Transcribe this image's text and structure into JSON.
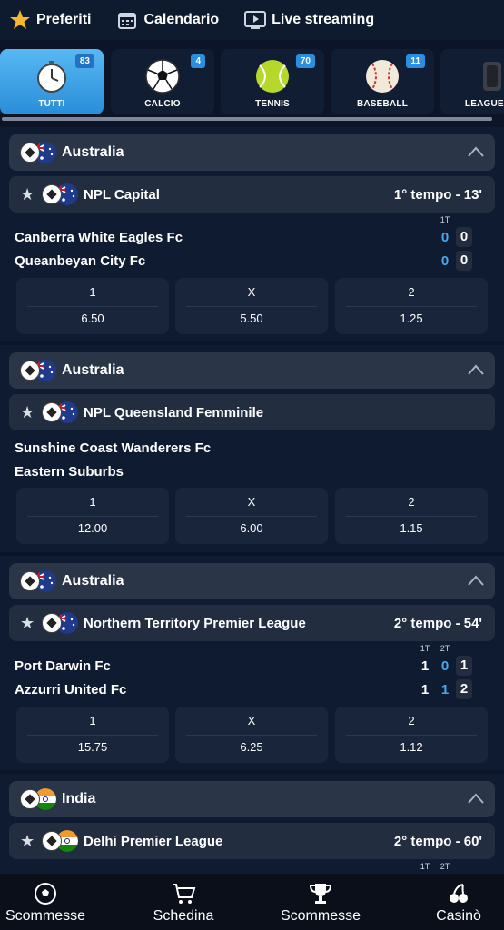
{
  "topnav": {
    "favorites": "Preferiti",
    "calendar": "Calendario",
    "live": "Live streaming"
  },
  "sports": [
    {
      "label": "TUTTI",
      "count": "83",
      "icon": "stopwatch-icon"
    },
    {
      "label": "CALCIO",
      "count": "4",
      "icon": "soccer-ball-icon"
    },
    {
      "label": "TENNIS",
      "count": "70",
      "icon": "tennis-ball-icon"
    },
    {
      "label": "BASEBALL",
      "count": "11",
      "icon": "baseball-icon"
    },
    {
      "label": "LEAGUE OF",
      "icon": "league-of-legends-icon"
    }
  ],
  "sections": [
    {
      "country": "Australia",
      "competition": "NPL Capital",
      "status": "1° tempo - 13'",
      "period_labels": [
        "1T"
      ],
      "home": "Canberra White Eagles Fc",
      "away": "Queanbeyan City Fc",
      "home_scores": [
        "0",
        "0"
      ],
      "away_scores": [
        "0",
        "0"
      ],
      "odds": [
        {
          "k": "1",
          "v": "6.50"
        },
        {
          "k": "X",
          "v": "5.50"
        },
        {
          "k": "2",
          "v": "1.25"
        }
      ]
    },
    {
      "country": "Australia",
      "competition": "NPL Queensland Femminile",
      "status": "",
      "home": "Sunshine Coast Wanderers Fc",
      "away": "Eastern Suburbs",
      "odds": [
        {
          "k": "1",
          "v": "12.00"
        },
        {
          "k": "X",
          "v": "6.00"
        },
        {
          "k": "2",
          "v": "1.15"
        }
      ]
    },
    {
      "country": "Australia",
      "competition": "Northern Territory Premier League",
      "status": "2° tempo - 54'",
      "period_labels": [
        "1T",
        "2T"
      ],
      "home": "Port Darwin Fc",
      "away": "Azzurri United Fc",
      "home_scores": [
        "1",
        "0",
        "1"
      ],
      "away_scores": [
        "1",
        "1",
        "2"
      ],
      "odds": [
        {
          "k": "1",
          "v": "15.75"
        },
        {
          "k": "X",
          "v": "6.25"
        },
        {
          "k": "2",
          "v": "1.12"
        }
      ]
    },
    {
      "country": "India",
      "competition": "Delhi Premier League",
      "status": "2° tempo - 60'",
      "period_labels": [
        "1T",
        "2T"
      ]
    }
  ],
  "bottomnav": [
    {
      "label": "Scommesse",
      "icon": "soccer-ball-icon"
    },
    {
      "label": "Schedina",
      "icon": "cart-icon"
    },
    {
      "label": "Scommesse",
      "icon": "trophy-icon"
    },
    {
      "label": "Casinò",
      "icon": "cherries-icon"
    }
  ],
  "colors": {
    "accent": "#49a7ee",
    "background": "#0b1527",
    "active_tile": "#3aa0e8"
  }
}
